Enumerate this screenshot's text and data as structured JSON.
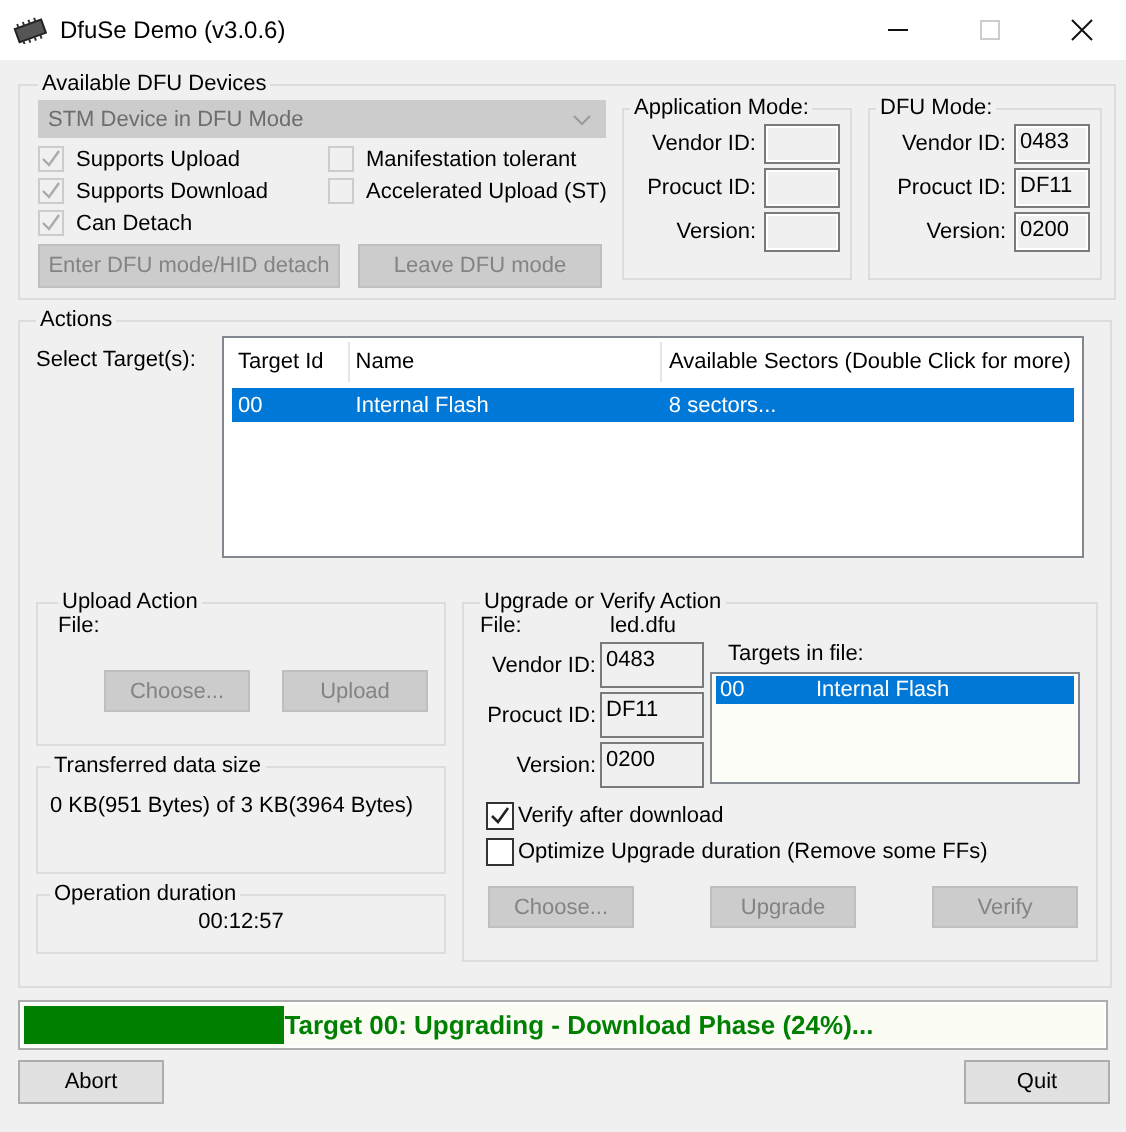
{
  "window": {
    "title": "DfuSe Demo (v3.0.6)"
  },
  "devices": {
    "label": "Available DFU Devices",
    "device": "STM Device in DFU Mode",
    "options": [
      {
        "label": "Supports Upload",
        "checked": true,
        "disabled": true
      },
      {
        "label": "Manifestation tolerant",
        "checked": false,
        "disabled": true
      },
      {
        "label": "Supports Download",
        "checked": true,
        "disabled": true
      },
      {
        "label": "Accelerated Upload (ST)",
        "checked": false,
        "disabled": true
      },
      {
        "label": "Can Detach",
        "checked": true,
        "disabled": true
      }
    ],
    "buttons": [
      {
        "label": "Enter DFU mode/HID detach",
        "disabled": true
      },
      {
        "label": "Leave DFU mode",
        "disabled": true
      }
    ]
  },
  "application_mode": {
    "label": "Application Mode:",
    "fields": [
      {
        "label": "Vendor ID:"
      },
      {
        "label": "Procuct ID:"
      },
      {
        "label": "Version:"
      }
    ]
  },
  "dfu_mode": {
    "label": "DFU Mode:",
    "fields": [
      {
        "label": "Vendor ID:",
        "value": "0483"
      },
      {
        "label": "Procuct ID:",
        "value": "DF11"
      },
      {
        "label": "Version:",
        "value": "0200"
      }
    ]
  },
  "actions": {
    "label": "Actions",
    "select_label": "Select Target(s):",
    "columns": [
      "Target Id",
      "Name",
      "Available Sectors (Double Click for more)"
    ],
    "rows": [
      {
        "cells": [
          "00",
          "Internal Flash",
          "8 sectors..."
        ],
        "selected": true
      }
    ]
  },
  "upload_action": {
    "label": "Upload Action",
    "file_label": "File:",
    "buttons": [
      {
        "label": "Choose...",
        "disabled": true
      },
      {
        "label": "Upload",
        "disabled": true
      }
    ]
  },
  "transferred": {
    "label": "Transferred data size",
    "text": "0 KB(951 Bytes) of 3 KB(3964 Bytes)"
  },
  "duration": {
    "label": "Operation duration",
    "text": "00:12:57"
  },
  "upgrade_action": {
    "label": "Upgrade or Verify Action",
    "file_label": "File:",
    "file": "led.dfu",
    "fields": [
      {
        "label": "Vendor ID:",
        "value": "0483"
      },
      {
        "label": "Procuct ID:",
        "value": "DF11"
      },
      {
        "label": "Version:",
        "value": "0200"
      }
    ],
    "targets_label": "Targets in file:",
    "targets": [
      {
        "id": "00",
        "name": "Internal Flash",
        "selected": true
      }
    ],
    "options": [
      {
        "label": "Verify after download",
        "checked": true,
        "disabled": false
      },
      {
        "label": "Optimize Upgrade duration (Remove some FFs)",
        "checked": false,
        "disabled": false
      }
    ],
    "buttons": [
      {
        "label": "Choose...",
        "disabled": true
      },
      {
        "label": "Upgrade",
        "disabled": true
      },
      {
        "label": "Verify",
        "disabled": true
      }
    ]
  },
  "progress": {
    "text": "Target 00: Upgrading - Download Phase (24%)...",
    "level": 0.24
  },
  "buttons": [
    {
      "label": "Abort",
      "disabled": false
    },
    {
      "label": "Quit",
      "disabled": false
    }
  ]
}
